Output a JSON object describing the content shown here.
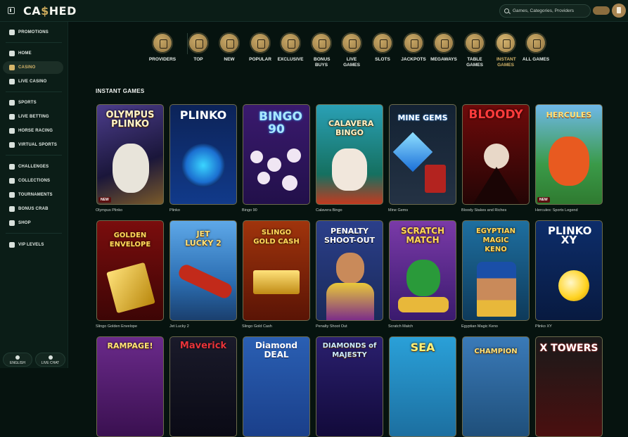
{
  "header": {
    "logo_text_pre": "CA",
    "logo_text_dollar": "$",
    "logo_text_post": "HED",
    "search_placeholder": "Games, Categories, Providers"
  },
  "sidebar": {
    "items": [
      {
        "label": "PROMOTIONS",
        "icon": "gift-icon"
      },
      {
        "label": "HOME",
        "icon": "home-icon"
      },
      {
        "label": "CASINO",
        "icon": "cards-icon",
        "active": true
      },
      {
        "label": "LIVE CASINO",
        "icon": "live-icon"
      },
      {
        "label": "SPORTS",
        "icon": "sports-icon"
      },
      {
        "label": "LIVE BETTING",
        "icon": "live-betting-icon"
      },
      {
        "label": "HORSE RACING",
        "icon": "horse-icon"
      },
      {
        "label": "VIRTUAL SPORTS",
        "icon": "virtual-sports-icon"
      },
      {
        "label": "CHALLENGES",
        "icon": "challenges-icon"
      },
      {
        "label": "COLLECTIONS",
        "icon": "collections-icon"
      },
      {
        "label": "TOURNAMENTS",
        "icon": "tournaments-icon"
      },
      {
        "label": "BONUS CRAB",
        "icon": "crab-icon"
      },
      {
        "label": "SHOP",
        "icon": "shop-icon"
      },
      {
        "label": "VIP LEVELS",
        "icon": "vip-icon"
      }
    ],
    "language_label": "ENGLISH",
    "live_chat_label": "LIVE CHAT"
  },
  "categories": [
    {
      "label": "PROVIDERS",
      "icon": "book-icon"
    },
    {
      "label": "TOP",
      "icon": "star-icon"
    },
    {
      "label": "NEW",
      "icon": "gift-box-icon"
    },
    {
      "label": "POPULAR",
      "icon": "flame-icon"
    },
    {
      "label": "EXCLUSIVE",
      "icon": "diamond-icon"
    },
    {
      "label": "BONUS BUYS",
      "icon": "bonus-icon"
    },
    {
      "label": "LIVE GAMES",
      "icon": "play-icon"
    },
    {
      "label": "SLOTS",
      "icon": "slot-machine-icon"
    },
    {
      "label": "JACKPOTS",
      "icon": "seven-icon"
    },
    {
      "label": "MEGAWAYS",
      "icon": "megaways-icon"
    },
    {
      "label": "TABLE GAMES",
      "icon": "cards-icon"
    },
    {
      "label": "INSTANT GAMES",
      "icon": "rocket-icon",
      "active": true
    },
    {
      "label": "ALL GAMES",
      "icon": "cherry-icon"
    }
  ],
  "section_title": "INSTANT GAMES",
  "games_row1": [
    {
      "name": "Olympus Plinko",
      "art": "OLYMPUS PLINKO",
      "badge": "NEW",
      "color": "#3a2f6b"
    },
    {
      "name": "Plinko",
      "art": "PLINKO",
      "color": "#0f2b6e"
    },
    {
      "name": "Bingo 90",
      "art": "BINGO 90",
      "color": "#3b1762"
    },
    {
      "name": "Calavera Bingo",
      "art": "CALAVERA BINGO",
      "color": "#1f7a8a"
    },
    {
      "name": "Mine Gems",
      "art": "MINE GEMS",
      "color": "#1d2a3a"
    },
    {
      "name": "Bloody Stakes and Riches",
      "art": "BLOODY",
      "color": "#5a0d0d"
    },
    {
      "name": "Hercules: Sports Legend",
      "art": "HERCULES",
      "badge": "NEW",
      "color": "#2f8a3a"
    }
  ],
  "games_row2": [
    {
      "name": "Slingo Golden Envelope",
      "art": "GOLDEN ENVELOPE",
      "color": "#6e0a0a"
    },
    {
      "name": "Jet Lucky 2",
      "art": "JET LUCKY 2",
      "color": "#2c6fb3"
    },
    {
      "name": "Slingo Gold Cash",
      "art": "SLINGO GOLD CASH",
      "color": "#7a2a0c"
    },
    {
      "name": "Penalty Shoot Out",
      "art": "PENALTY SHOOT-OUT",
      "color": "#2b3f8a"
    },
    {
      "name": "Scratch Match",
      "art": "SCRATCH MATCH",
      "color": "#5c2a8a"
    },
    {
      "name": "Egyptian Magic Keno",
      "art": "EGYPTIAN MAGIC KENO",
      "color": "#1e6fa0"
    },
    {
      "name": "Plinko XY",
      "art": "PLINKO XY",
      "color": "#0d2d6a"
    }
  ],
  "games_row3": [
    {
      "art": "RAMPAGE!",
      "color": "#6a2a8a"
    },
    {
      "art": "Maverick",
      "color": "#8a1010"
    },
    {
      "art": "Diamond DEAL",
      "color": "#1a3f8a"
    },
    {
      "art": "DIAMONDS of MAJESTY",
      "color": "#2a1f6e"
    },
    {
      "art": "SEA",
      "color": "#1c6fa0"
    },
    {
      "art": "CHAMPION",
      "color": "#1f4f7a"
    },
    {
      "art": "X TOWERS",
      "color": "#4a0f0f"
    }
  ]
}
